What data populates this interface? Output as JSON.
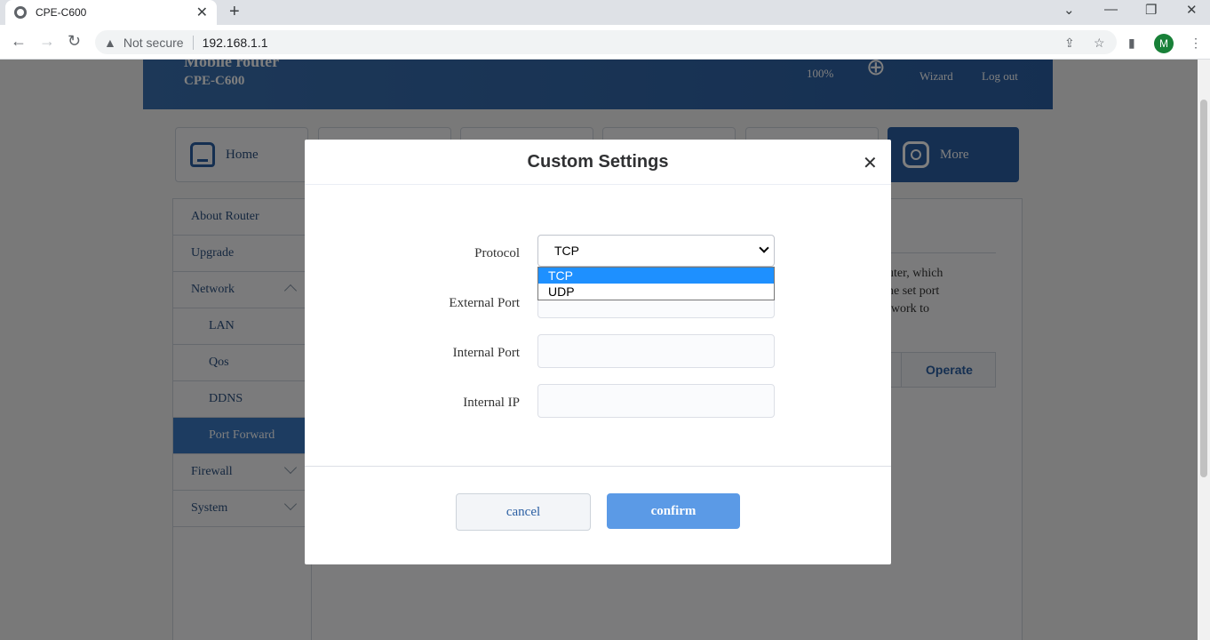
{
  "browser": {
    "tab_title": "CPE-C600",
    "tab_close": "✕",
    "new_tab": "+",
    "security_label": "Not secure",
    "url": "192.168.1.1",
    "profile_initial": "M"
  },
  "router": {
    "brand_line1": "Mobile router",
    "brand_line2": "CPE-C600",
    "battery": "100%",
    "wizard": "Wizard",
    "logout": "Log out"
  },
  "nav": {
    "home": "Home",
    "more": "More"
  },
  "sidebar": {
    "items": [
      {
        "label": "About Router"
      },
      {
        "label": "Upgrade"
      },
      {
        "label": "Network"
      },
      {
        "label": "LAN"
      },
      {
        "label": "Qos"
      },
      {
        "label": "DDNS"
      },
      {
        "label": "Port Forward"
      },
      {
        "label": "Firewall"
      },
      {
        "label": "System"
      }
    ]
  },
  "content": {
    "desc_fragment": "uter, which\nne set port\ntwork to",
    "operate_header": "Operate"
  },
  "modal": {
    "title": "Custom Settings",
    "close": "✕",
    "protocol_label": "Protocol",
    "protocol_value": "TCP",
    "protocol_options": [
      "TCP",
      "UDP"
    ],
    "external_port_label": "External Port",
    "internal_port_label": "Internal Port",
    "internal_ip_label": "Internal IP",
    "cancel": "cancel",
    "confirm": "confirm"
  }
}
